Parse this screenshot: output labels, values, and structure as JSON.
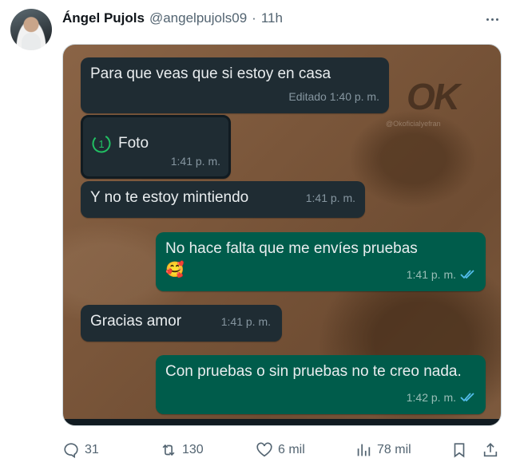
{
  "tweet": {
    "author_name": "Ángel Pujols",
    "handle": "@angelpujols09",
    "separator": "·",
    "time": "11h"
  },
  "image": {
    "watermark": "OK",
    "watermark_sub": "@Okoficialyefran",
    "messages": [
      {
        "direction": "in",
        "text": "Para que veas que si estoy en casa",
        "meta": "Editado 1:40 p. m."
      },
      {
        "direction": "in",
        "text": "Foto",
        "meta": "1:41 p. m.",
        "type": "photo",
        "icon": "view-once-icon"
      },
      {
        "direction": "in",
        "text": "Y no te estoy mintiendo",
        "meta": "1:41 p. m."
      },
      {
        "direction": "out",
        "text": "No hace falta que me envíes pruebas",
        "emoji": "🥰",
        "meta": "1:41 p. m.",
        "status": "read"
      },
      {
        "direction": "in",
        "text": "Gracias amor",
        "meta": "1:41 p. m."
      },
      {
        "direction": "out",
        "text": "Con pruebas o sin pruebas no te creo nada.",
        "meta": "1:42 p. m.",
        "status": "read"
      }
    ],
    "colors": {
      "incoming": "#1f2c33",
      "outgoing": "#005c4b",
      "read_ticks": "#53bdeb"
    }
  },
  "actions": {
    "reply_count": "31",
    "retweet_count": "130",
    "like_count": "6 mil",
    "view_count": "78 mil"
  }
}
